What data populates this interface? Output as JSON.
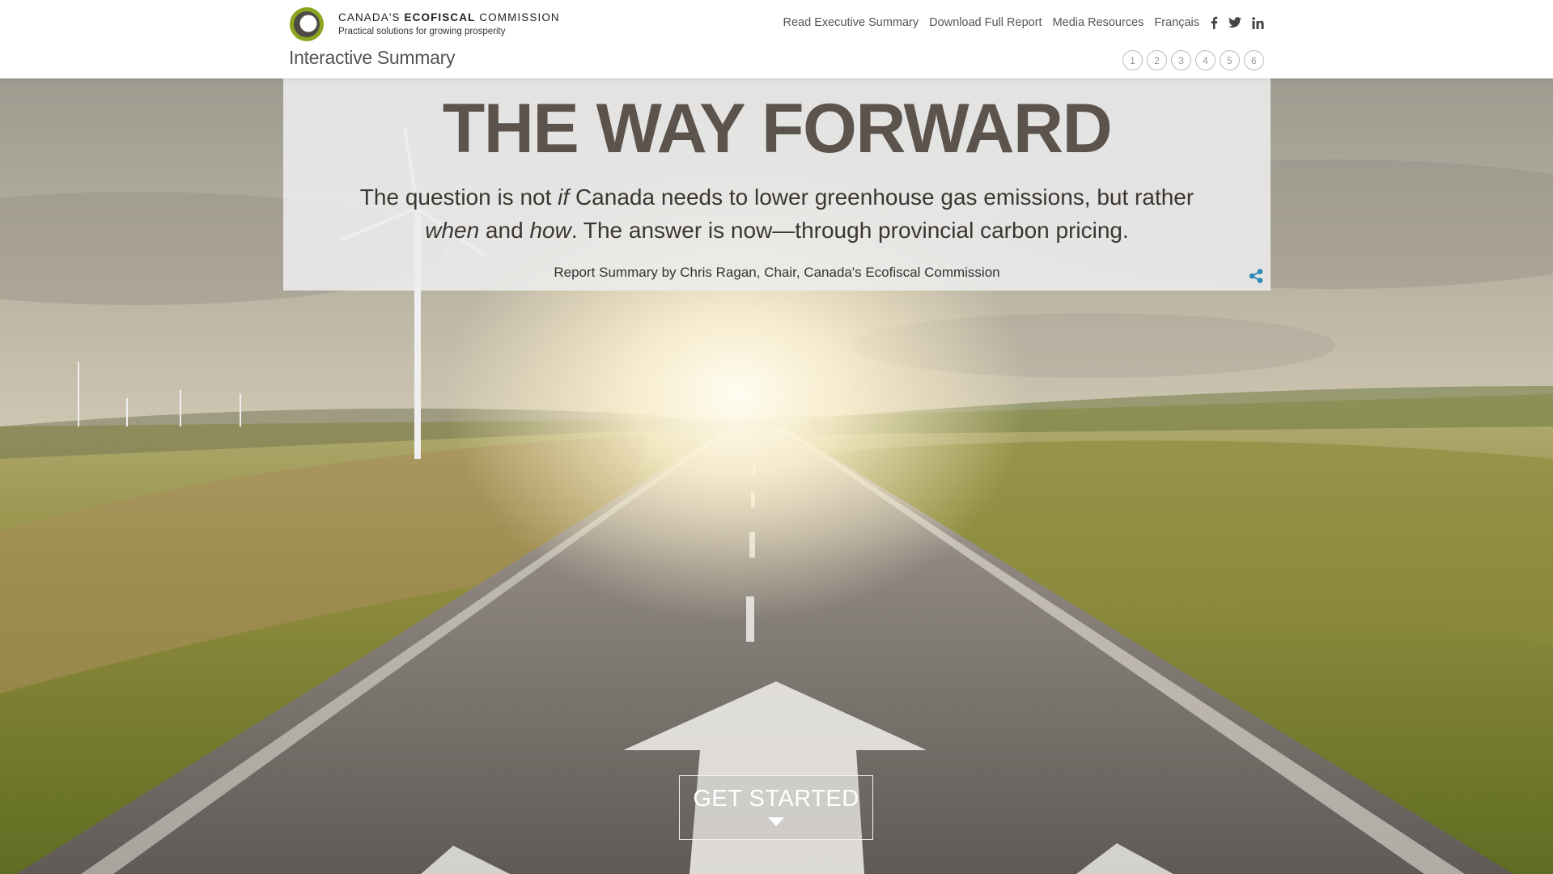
{
  "header": {
    "brand_prefix": "CANADA'S",
    "brand_bold": "ECOFISCAL",
    "brand_suffix": "COMMISSION",
    "tagline": "Practical solutions for growing prosperity",
    "subtitle": "Interactive Summary"
  },
  "nav": {
    "items": [
      {
        "label": "Read Executive Summary"
      },
      {
        "label": "Download Full Report"
      },
      {
        "label": "Media Resources"
      },
      {
        "label": "Français"
      }
    ],
    "social": [
      "facebook-icon",
      "twitter-icon",
      "linkedin-icon"
    ]
  },
  "pager": {
    "pages": [
      "1",
      "2",
      "3",
      "4",
      "5",
      "6"
    ]
  },
  "hero": {
    "title": "THE WAY FORWARD",
    "lede_1": "The question is not ",
    "lede_if": "if",
    "lede_2": " Canada needs to lower greenhouse gas emissions, but rather",
    "lede_when": "when",
    "lede_3": " and ",
    "lede_how": "how",
    "lede_4": ". The answer is now—through provincial carbon pricing.",
    "byline": "Report Summary by Chris Ragan, Chair, Canada's Ecofiscal Commission",
    "share_icon": "share-icon"
  },
  "cta": {
    "label": "GET STARTED"
  },
  "colors": {
    "logo_green": "#8aa51f",
    "title": "#5b534c",
    "accent_blue": "#2f88b8"
  }
}
